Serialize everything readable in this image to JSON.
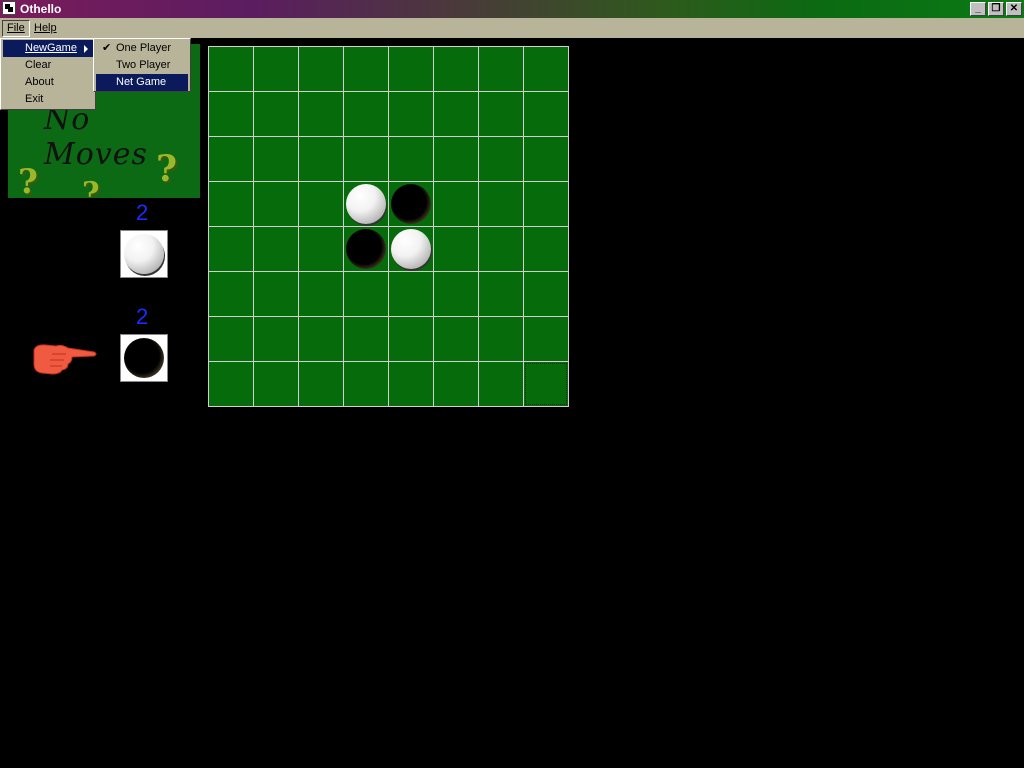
{
  "window": {
    "title": "Othello"
  },
  "menubar": {
    "file": "File",
    "help": "Help"
  },
  "file_menu": {
    "items": [
      "NewGame",
      "Clear",
      "About",
      "Exit"
    ]
  },
  "newgame_submenu": {
    "items": [
      "One Player",
      "Two Player",
      "Net Game"
    ],
    "checked": "One Player",
    "highlighted": "Net Game"
  },
  "preview": {
    "text": "No Moves"
  },
  "scores": {
    "white": "2",
    "black": "2"
  },
  "turn": "black",
  "board": {
    "rows": 8,
    "cols": 8,
    "pieces": [
      {
        "row": 3,
        "col": 3,
        "color": "white"
      },
      {
        "row": 3,
        "col": 4,
        "color": "black"
      },
      {
        "row": 4,
        "col": 3,
        "color": "black"
      },
      {
        "row": 4,
        "col": 4,
        "color": "white"
      }
    ],
    "focused_cell": {
      "row": 7,
      "col": 7
    }
  },
  "colors": {
    "board_green": "#066b0a",
    "score_blue": "#1a2cff",
    "menu_bg": "#b8b49a",
    "highlight": "#0a1a5a"
  }
}
